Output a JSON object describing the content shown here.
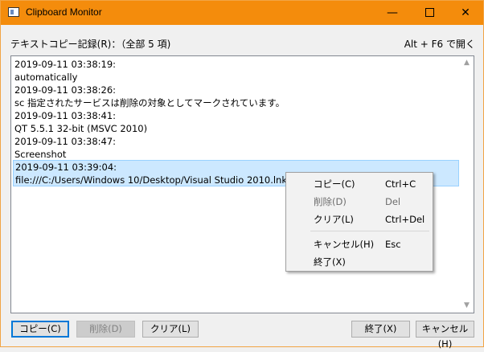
{
  "window": {
    "title": "Clipboard Monitor",
    "minimize_glyph": "—",
    "close_glyph": "✕"
  },
  "history": {
    "label": "テキストコピー記録(R)：（全部 5 項)",
    "hotkey_hint": "Alt + F6 で開く",
    "entries": [
      {
        "timestamp": "2019-09-11 03:38:19:",
        "text": "automatically"
      },
      {
        "timestamp": "2019-09-11 03:38:26:",
        "text": "sc 指定されたサービスは削除の対象としてマークされています。"
      },
      {
        "timestamp": "2019-09-11 03:38:41:",
        "text": "QT 5.5.1 32-bit (MSVC 2010)"
      },
      {
        "timestamp": "2019-09-11 03:38:47:",
        "text": "Screenshot"
      },
      {
        "timestamp": "2019-09-11 03:39:04:",
        "text": "file:///C:/Users/Windows 10/Desktop/Visual Studio 2010.lnk"
      }
    ],
    "selected_index": 4
  },
  "context_menu": {
    "items": [
      {
        "label": "コピー(C)",
        "shortcut": "Ctrl+C"
      },
      {
        "label": "削除(D)",
        "shortcut": "Del"
      },
      {
        "label": "クリア(L)",
        "shortcut": "Ctrl+Del"
      },
      {
        "label": "キャンセル(H)",
        "shortcut": "Esc"
      },
      {
        "label": "終了(X)",
        "shortcut": ""
      }
    ]
  },
  "buttons": {
    "copy": "コピー(C)",
    "delete": "削除(D)",
    "clear": "クリア(L)",
    "exit": "終了(X)",
    "cancel": "キャンセル(H)"
  },
  "icons": {
    "app": "app-window-icon",
    "scroll_up": "▲",
    "scroll_down": "▼"
  },
  "colors": {
    "titlebar": "#f48c0c",
    "selection": "#cce8ff",
    "focus_border": "#0078d7"
  }
}
